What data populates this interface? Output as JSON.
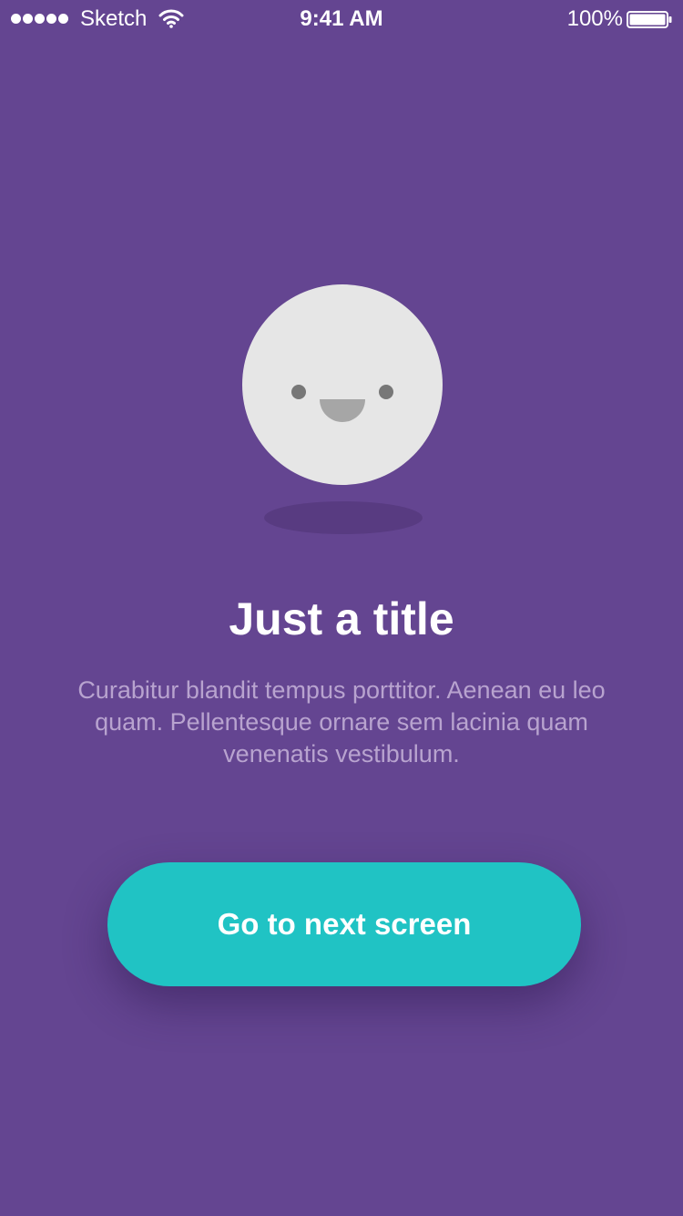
{
  "status_bar": {
    "carrier": "Sketch",
    "time": "9:41 AM",
    "battery_percent": "100%",
    "signal_bars": 5,
    "icons": [
      "signal-dots-icon",
      "wifi-icon",
      "battery-icon"
    ]
  },
  "hero": {
    "illustration": "smiley-face-icon"
  },
  "content": {
    "title": "Just a title",
    "body": "Curabitur blandit tempus porttitor. Aenean eu leo quam. Pellentesque ornare sem lacinia quam venenatis vestibulum."
  },
  "actions": {
    "next_label": "Go to next screen"
  },
  "colors": {
    "background": "#644591",
    "button": "#20c3c4",
    "face": "#e6e6e6",
    "body_text": "#b8a3cf"
  }
}
